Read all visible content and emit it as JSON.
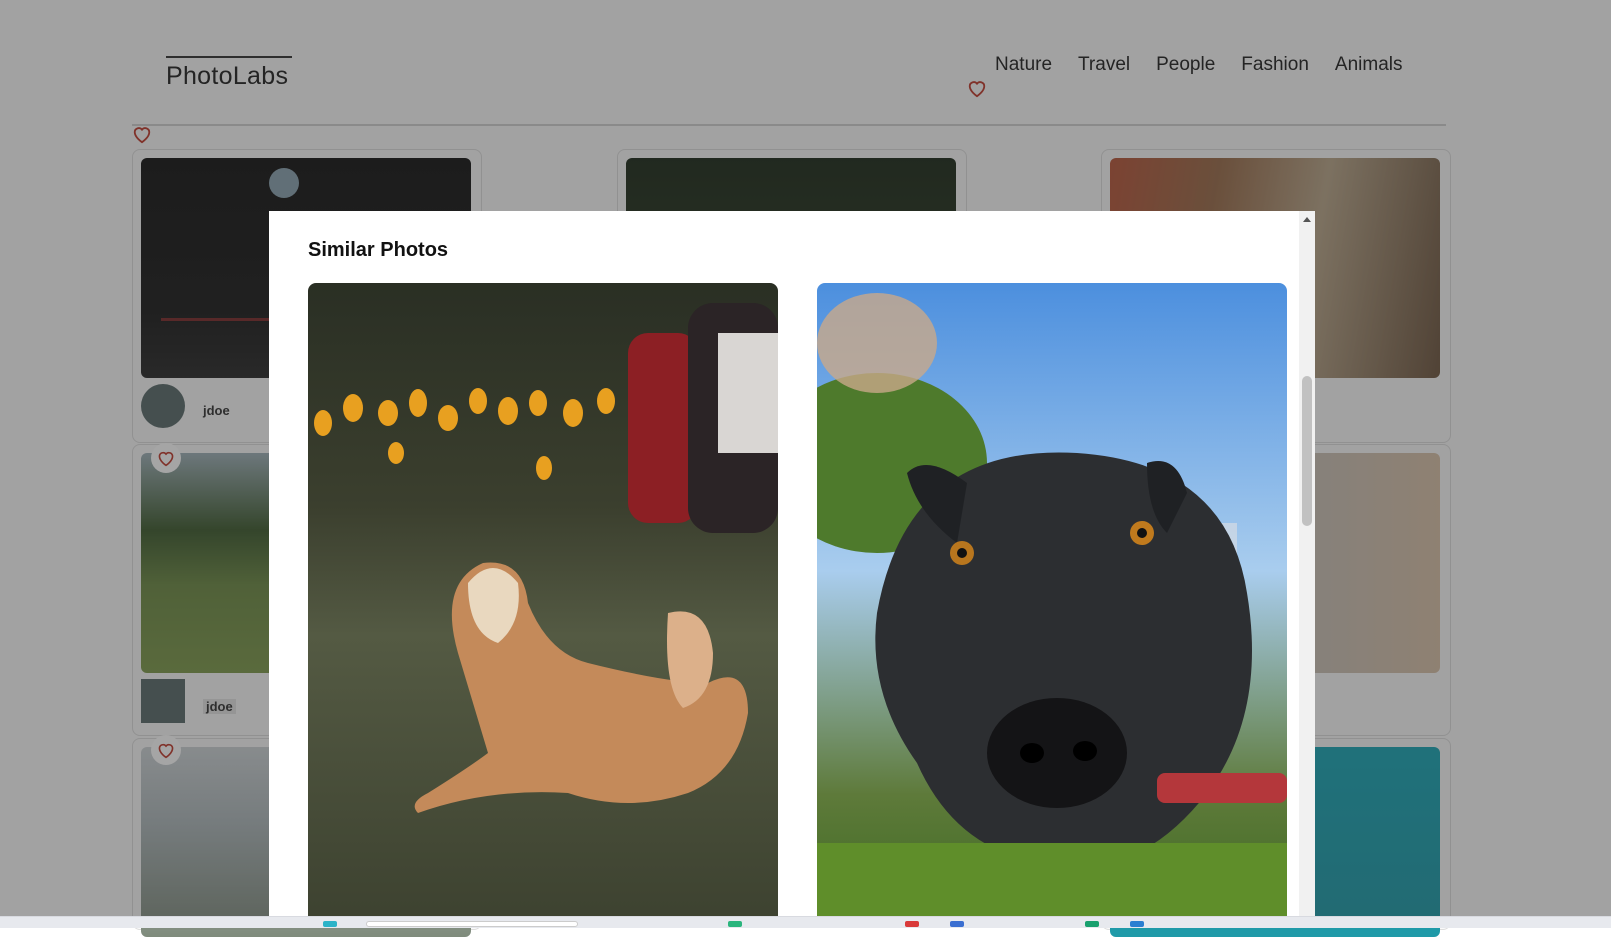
{
  "app": {
    "logo": "PhotoLabs"
  },
  "nav": {
    "topics": [
      "Nature",
      "Travel",
      "People",
      "Fashion",
      "Animals"
    ]
  },
  "grid": {
    "cards": [
      {
        "username": "jdoe"
      },
      {
        "username": "jdoe"
      }
    ]
  },
  "modal": {
    "title": "Similar Photos"
  },
  "colors": {
    "heart": "#c0392b",
    "overlay": "rgba(40,40,40,0.42)"
  },
  "icons": [
    "heart-icon",
    "close-icon",
    "scroll-up-arrow-icon"
  ]
}
